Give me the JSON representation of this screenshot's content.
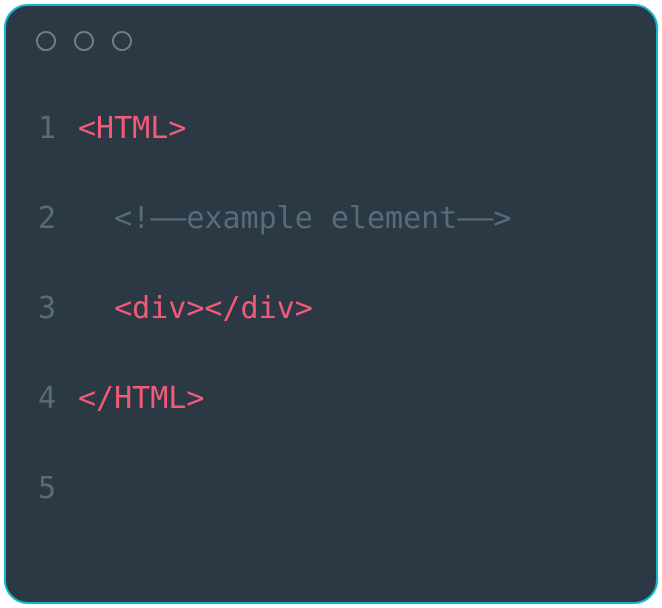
{
  "editor": {
    "lines": [
      {
        "num": "1",
        "indent": "",
        "class": "tag",
        "text": "<HTML>"
      },
      {
        "num": "2",
        "indent": "  ",
        "class": "comment",
        "text": "<!——example element——>"
      },
      {
        "num": "3",
        "indent": "  ",
        "class": "tag",
        "text": "<div></div>"
      },
      {
        "num": "4",
        "indent": "",
        "class": "tag",
        "text": "</HTML>"
      },
      {
        "num": "5",
        "indent": "",
        "class": "",
        "text": ""
      }
    ]
  },
  "colors": {
    "bg": "#2b3945",
    "border": "#14b7c9",
    "tag": "#f25a78",
    "comment": "#5a6b78",
    "lineno": "#5a6b78"
  }
}
